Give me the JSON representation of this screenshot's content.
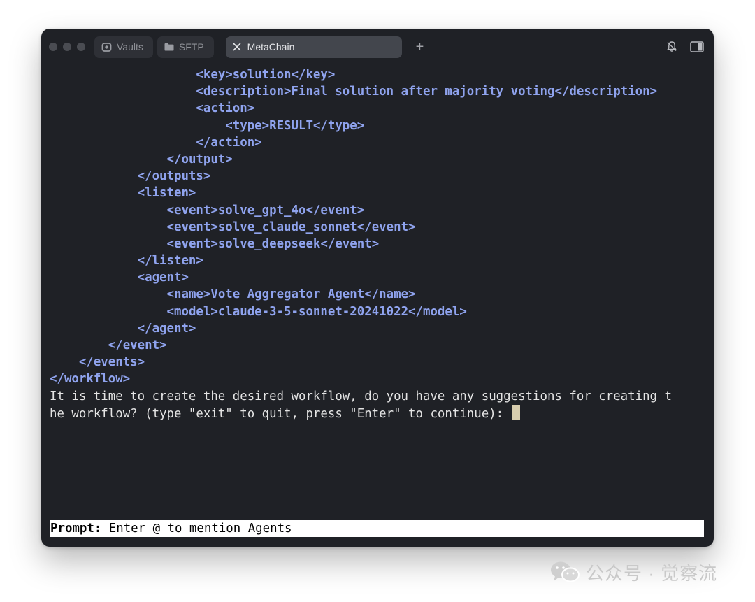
{
  "tabs": [
    {
      "label": "Vaults",
      "icon": "vault-icon"
    },
    {
      "label": "SFTP",
      "icon": "folder-icon"
    },
    {
      "label": "MetaChain",
      "icon": "close-icon",
      "active": true
    }
  ],
  "new_tab_label": "+",
  "terminal": {
    "lines": [
      {
        "indent": "                    ",
        "text": "<key>solution</key>",
        "kind": "xml"
      },
      {
        "indent": "                    ",
        "text": "<description>Final solution after majority voting</description>",
        "kind": "xml"
      },
      {
        "indent": "                    ",
        "text": "<action>",
        "kind": "xml"
      },
      {
        "indent": "                        ",
        "text": "<type>RESULT</type>",
        "kind": "xml"
      },
      {
        "indent": "                    ",
        "text": "</action>",
        "kind": "xml"
      },
      {
        "indent": "                ",
        "text": "</output>",
        "kind": "xml"
      },
      {
        "indent": "            ",
        "text": "</outputs>",
        "kind": "xml"
      },
      {
        "indent": "            ",
        "text": "<listen>",
        "kind": "xml"
      },
      {
        "indent": "                ",
        "text": "<event>solve_gpt_4o</event>",
        "kind": "xml"
      },
      {
        "indent": "                ",
        "text": "<event>solve_claude_sonnet</event>",
        "kind": "xml"
      },
      {
        "indent": "                ",
        "text": "<event>solve_deepseek</event>",
        "kind": "xml"
      },
      {
        "indent": "            ",
        "text": "</listen>",
        "kind": "xml"
      },
      {
        "indent": "            ",
        "text": "<agent>",
        "kind": "xml"
      },
      {
        "indent": "                ",
        "text": "<name>Vote Aggregator Agent</name>",
        "kind": "xml"
      },
      {
        "indent": "                ",
        "text": "<model>claude-3-5-sonnet-20241022</model>",
        "kind": "xml"
      },
      {
        "indent": "            ",
        "text": "</agent>",
        "kind": "xml"
      },
      {
        "indent": "        ",
        "text": "</event>",
        "kind": "xml"
      },
      {
        "indent": "    ",
        "text": "</events>",
        "kind": "xml"
      },
      {
        "indent": "",
        "text": "</workflow>",
        "kind": "xml"
      },
      {
        "indent": "",
        "text": "It is time to create the desired workflow, do you have any suggestions for creating t",
        "kind": "plain"
      },
      {
        "indent": "",
        "text": "he workflow? (type \"exit\" to quit, press \"Enter\" to continue): ",
        "kind": "plain",
        "cursor": true
      }
    ]
  },
  "prompt": {
    "label": "Prompt:",
    "placeholder": " Enter @ to mention Agents"
  },
  "watermark": {
    "text": "公众号 · 觉察流"
  },
  "colors": {
    "window_bg": "#1f2126",
    "xml_text": "#8fa3ee",
    "plain_text": "#e4e4e4",
    "cursor": "#d7cdae",
    "active_tab": "#43464d"
  }
}
